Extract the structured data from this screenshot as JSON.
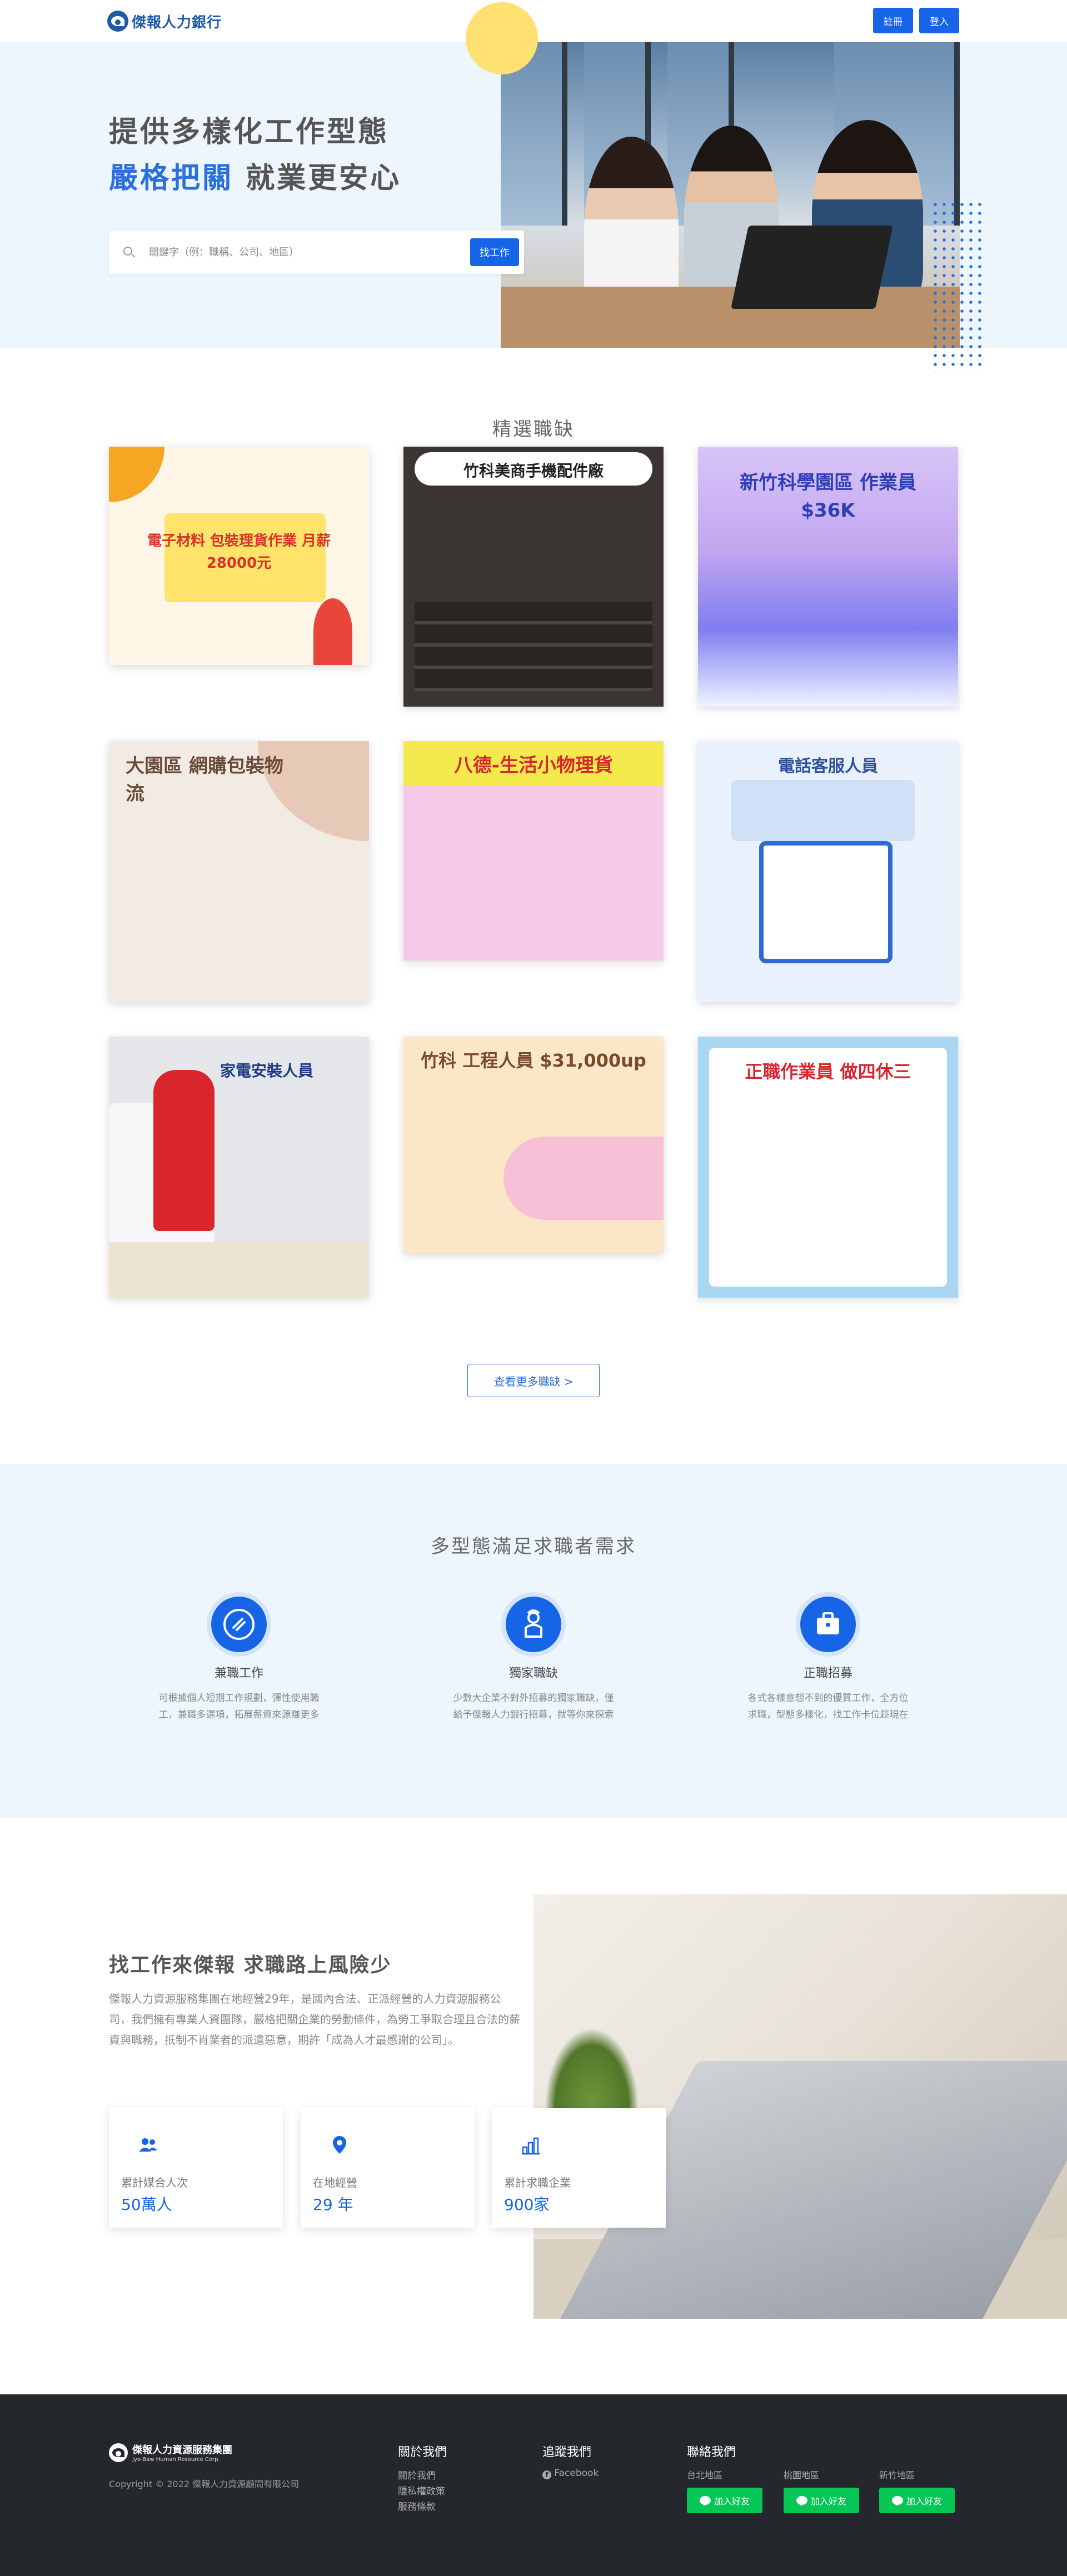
{
  "header": {
    "logo_text": "傑報人力銀行",
    "register_label": "註冊",
    "login_label": "登入"
  },
  "hero": {
    "title_line1": "提供多樣化工作型態",
    "title_highlight": "嚴格把關",
    "title_line2_rest": " 就業更安心",
    "search_placeholder": "關鍵字（例：職稱、公司、地區）",
    "search_button": "找工作"
  },
  "jobs": {
    "section_title": "精選職缺",
    "cards": [
      {
        "caption": "電子材料 包裝理貨作業 月薪28000元",
        "bg": "#fff6e8"
      },
      {
        "caption": "竹科美商手機配件廠",
        "bg": "#3a3432"
      },
      {
        "caption": "新竹科學園區 作業員 $36K",
        "bg": "#c9a8f0"
      },
      {
        "caption": "大園區 網購包裝物流",
        "bg": "#f2ebe4"
      },
      {
        "caption": "八德-生活小物理貨",
        "bg": "#f7c9e8"
      },
      {
        "caption": "電話客服人員",
        "bg": "#e8f1fc"
      },
      {
        "caption": "家電安裝人員",
        "bg": "#e4e6ea"
      },
      {
        "caption": "竹科 工程人員 $31,000up",
        "bg": "#fbe7c8"
      },
      {
        "caption": "正職作業員 做四休三",
        "bg": "#a9d7f3"
      }
    ],
    "more_button": "查看更多職缺 >"
  },
  "features": {
    "title": "多型態滿足求職者需求",
    "items": [
      {
        "title": "兼職工作",
        "desc_line1": "可根據個人短期工作規劃，彈性使用職",
        "desc_line2": "工，兼職多選項，拓展薪資來源賺更多"
      },
      {
        "title": "獨家職缺",
        "desc_line1": "少數大企業不對外招募的獨家職缺，僅",
        "desc_line2": "給予傑報人力銀行招募，就等你來探索"
      },
      {
        "title": "正職招募",
        "desc_line1": "各式各樣意想不到的優質工作，全方位",
        "desc_line2": "求職，型態多樣化，找工作卡位趁現在"
      }
    ]
  },
  "about": {
    "title": "找工作來傑報 求職路上風險少",
    "desc": "傑報人力資源服務集團在地經營29年，是國內合法、正派經營的人力資源服務公司，我們擁有專業人資團隊，嚴格把關企業的勞動條件，為勞工爭取合理且合法的薪資與職務，抵制不肖業者的派遣惡意，期許「成為人才最感謝的公司」。",
    "stats": [
      {
        "label": "累計媒合人次",
        "value": "50萬人",
        "icon": "users-icon"
      },
      {
        "label": "在地經營",
        "value": "29 年",
        "icon": "location-pin-icon"
      },
      {
        "label": "累計求職企業",
        "value": "900家",
        "icon": "building-chart-icon"
      }
    ]
  },
  "footer": {
    "logo_cn": "傑報人力資源服務集團",
    "logo_en": "Jye-Baw Human Resource Corp.",
    "copyright": "Copyright © 2022 傑報人力資源顧問有限公司",
    "about_title": "關於我們",
    "about_links": [
      "關於我們",
      "隱私權政策",
      "服務條款"
    ],
    "follow_title": "追蹤我們",
    "facebook": "Facebook",
    "contact_title": "聯絡我們",
    "regions": [
      {
        "name": "台北地區",
        "button": "加入好友"
      },
      {
        "name": "桃園地區",
        "button": "加入好友"
      },
      {
        "name": "新竹地區",
        "button": "加入好友"
      }
    ]
  },
  "colors": {
    "accent": "#1565e6",
    "hero_bg": "#eef6fd",
    "footer_bg": "#24282d",
    "line_green": "#06c755"
  }
}
